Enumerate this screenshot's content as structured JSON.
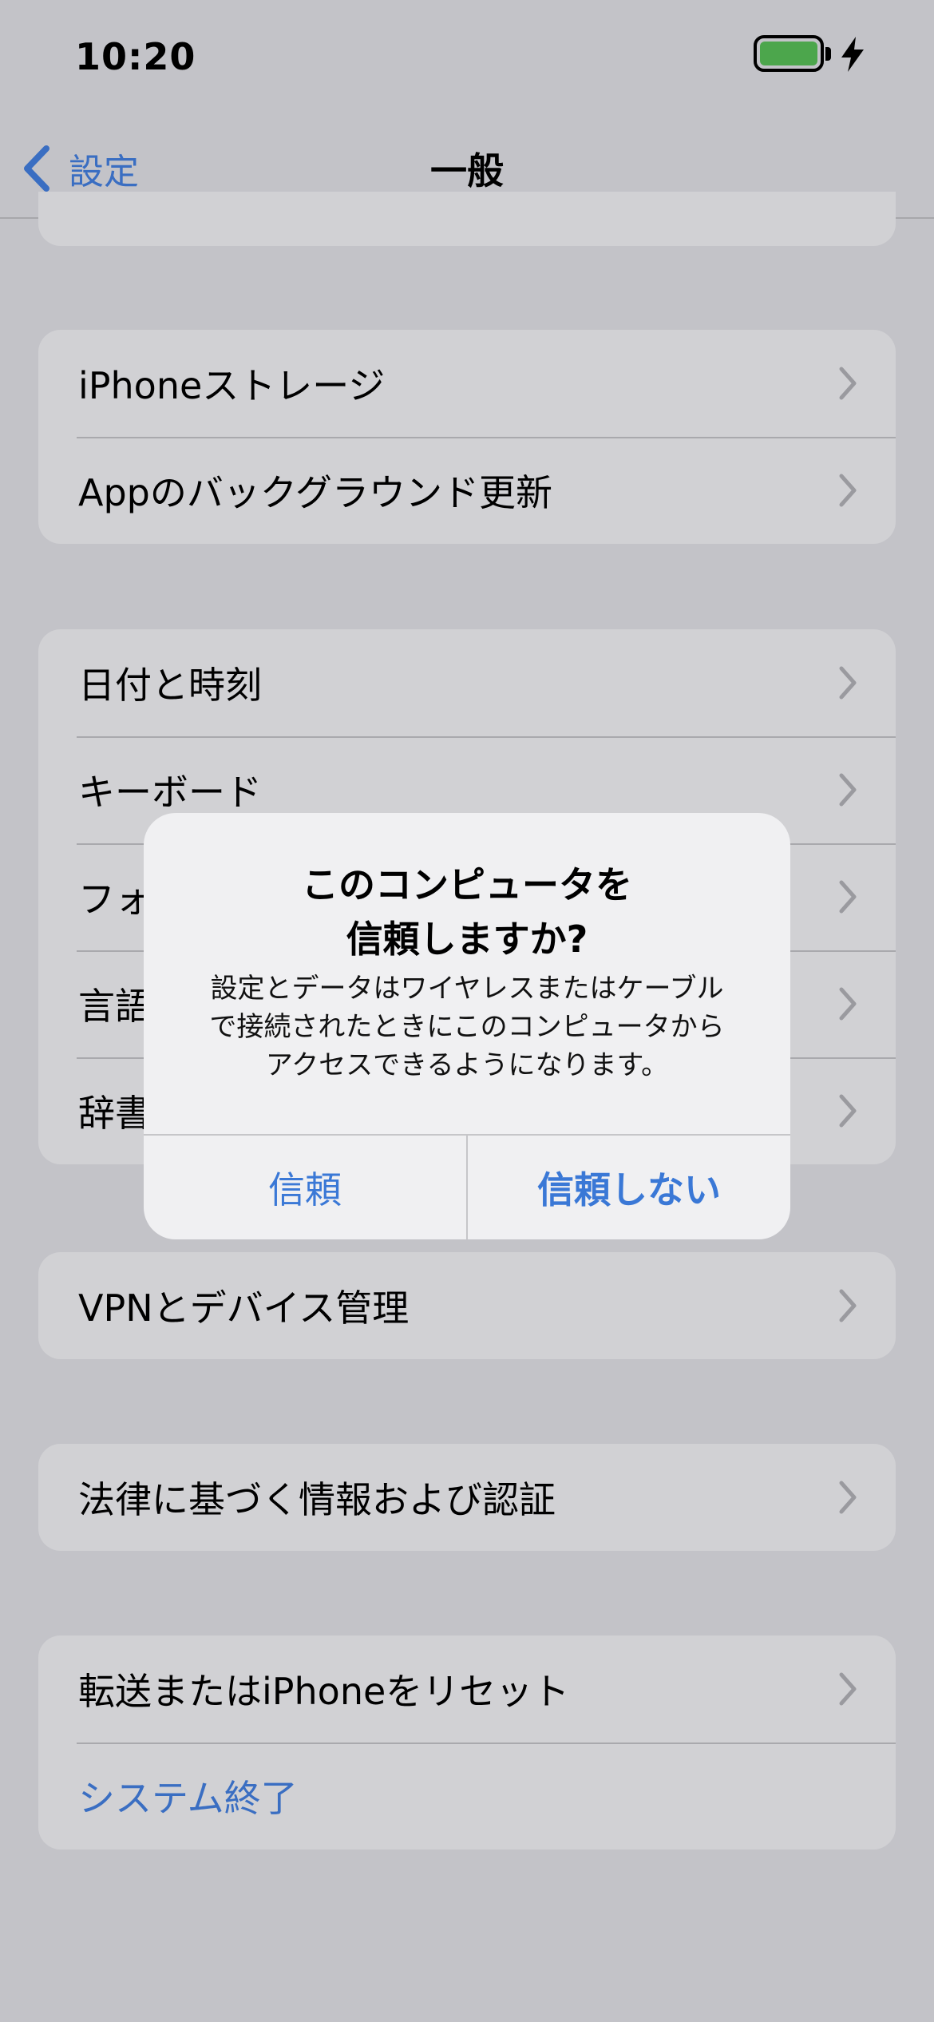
{
  "status_bar": {
    "time": "10:20"
  },
  "nav": {
    "back_label": "設定",
    "title": "一般"
  },
  "groups": [
    {
      "items": [
        {
          "label": "iPhoneストレージ"
        },
        {
          "label": "Appのバックグラウンド更新"
        }
      ]
    },
    {
      "items": [
        {
          "label": "日付と時刻"
        },
        {
          "label": "キーボード"
        },
        {
          "label": "フォント"
        },
        {
          "label": "言語と地域"
        },
        {
          "label": "辞書"
        }
      ]
    },
    {
      "items": [
        {
          "label": "VPNとデバイス管理"
        }
      ]
    },
    {
      "items": [
        {
          "label": "法律に基づく情報および認証"
        }
      ]
    },
    {
      "items": [
        {
          "label": "転送またはiPhoneをリセット"
        },
        {
          "label": "システム終了"
        }
      ]
    }
  ],
  "dialog": {
    "title_line1": "このコンピュータを",
    "title_line2": "信頼しますか?",
    "message_line1": "設定とデータはワイヤレスまたはケーブル",
    "message_line2": "で接続されたときにこのコンピュータから",
    "message_line3": "アクセスできるようになります。",
    "trust_label": "信頼",
    "dont_trust_label": "信頼しない"
  },
  "colors": {
    "accent": "#3a6ec2",
    "dialog_button": "#3a78d6",
    "battery": "#4ca64c"
  },
  "battery": {
    "level": 1.0,
    "charging": true
  }
}
